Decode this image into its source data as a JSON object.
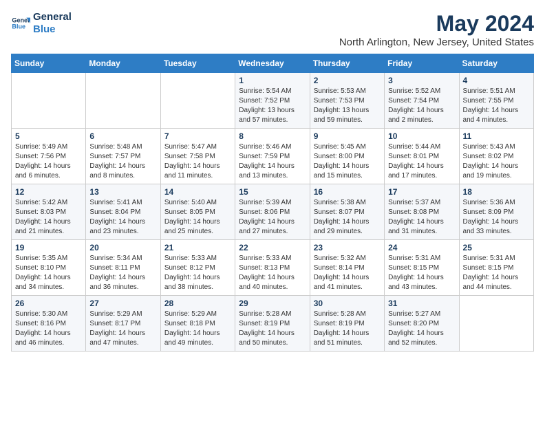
{
  "logo": {
    "line1": "General",
    "line2": "Blue"
  },
  "title": "May 2024",
  "subtitle": "North Arlington, New Jersey, United States",
  "weekdays": [
    "Sunday",
    "Monday",
    "Tuesday",
    "Wednesday",
    "Thursday",
    "Friday",
    "Saturday"
  ],
  "weeks": [
    [
      {
        "day": "",
        "info": ""
      },
      {
        "day": "",
        "info": ""
      },
      {
        "day": "",
        "info": ""
      },
      {
        "day": "1",
        "info": "Sunrise: 5:54 AM\nSunset: 7:52 PM\nDaylight: 13 hours\nand 57 minutes."
      },
      {
        "day": "2",
        "info": "Sunrise: 5:53 AM\nSunset: 7:53 PM\nDaylight: 13 hours\nand 59 minutes."
      },
      {
        "day": "3",
        "info": "Sunrise: 5:52 AM\nSunset: 7:54 PM\nDaylight: 14 hours\nand 2 minutes."
      },
      {
        "day": "4",
        "info": "Sunrise: 5:51 AM\nSunset: 7:55 PM\nDaylight: 14 hours\nand 4 minutes."
      }
    ],
    [
      {
        "day": "5",
        "info": "Sunrise: 5:49 AM\nSunset: 7:56 PM\nDaylight: 14 hours\nand 6 minutes."
      },
      {
        "day": "6",
        "info": "Sunrise: 5:48 AM\nSunset: 7:57 PM\nDaylight: 14 hours\nand 8 minutes."
      },
      {
        "day": "7",
        "info": "Sunrise: 5:47 AM\nSunset: 7:58 PM\nDaylight: 14 hours\nand 11 minutes."
      },
      {
        "day": "8",
        "info": "Sunrise: 5:46 AM\nSunset: 7:59 PM\nDaylight: 14 hours\nand 13 minutes."
      },
      {
        "day": "9",
        "info": "Sunrise: 5:45 AM\nSunset: 8:00 PM\nDaylight: 14 hours\nand 15 minutes."
      },
      {
        "day": "10",
        "info": "Sunrise: 5:44 AM\nSunset: 8:01 PM\nDaylight: 14 hours\nand 17 minutes."
      },
      {
        "day": "11",
        "info": "Sunrise: 5:43 AM\nSunset: 8:02 PM\nDaylight: 14 hours\nand 19 minutes."
      }
    ],
    [
      {
        "day": "12",
        "info": "Sunrise: 5:42 AM\nSunset: 8:03 PM\nDaylight: 14 hours\nand 21 minutes."
      },
      {
        "day": "13",
        "info": "Sunrise: 5:41 AM\nSunset: 8:04 PM\nDaylight: 14 hours\nand 23 minutes."
      },
      {
        "day": "14",
        "info": "Sunrise: 5:40 AM\nSunset: 8:05 PM\nDaylight: 14 hours\nand 25 minutes."
      },
      {
        "day": "15",
        "info": "Sunrise: 5:39 AM\nSunset: 8:06 PM\nDaylight: 14 hours\nand 27 minutes."
      },
      {
        "day": "16",
        "info": "Sunrise: 5:38 AM\nSunset: 8:07 PM\nDaylight: 14 hours\nand 29 minutes."
      },
      {
        "day": "17",
        "info": "Sunrise: 5:37 AM\nSunset: 8:08 PM\nDaylight: 14 hours\nand 31 minutes."
      },
      {
        "day": "18",
        "info": "Sunrise: 5:36 AM\nSunset: 8:09 PM\nDaylight: 14 hours\nand 33 minutes."
      }
    ],
    [
      {
        "day": "19",
        "info": "Sunrise: 5:35 AM\nSunset: 8:10 PM\nDaylight: 14 hours\nand 34 minutes."
      },
      {
        "day": "20",
        "info": "Sunrise: 5:34 AM\nSunset: 8:11 PM\nDaylight: 14 hours\nand 36 minutes."
      },
      {
        "day": "21",
        "info": "Sunrise: 5:33 AM\nSunset: 8:12 PM\nDaylight: 14 hours\nand 38 minutes."
      },
      {
        "day": "22",
        "info": "Sunrise: 5:33 AM\nSunset: 8:13 PM\nDaylight: 14 hours\nand 40 minutes."
      },
      {
        "day": "23",
        "info": "Sunrise: 5:32 AM\nSunset: 8:14 PM\nDaylight: 14 hours\nand 41 minutes."
      },
      {
        "day": "24",
        "info": "Sunrise: 5:31 AM\nSunset: 8:15 PM\nDaylight: 14 hours\nand 43 minutes."
      },
      {
        "day": "25",
        "info": "Sunrise: 5:31 AM\nSunset: 8:15 PM\nDaylight: 14 hours\nand 44 minutes."
      }
    ],
    [
      {
        "day": "26",
        "info": "Sunrise: 5:30 AM\nSunset: 8:16 PM\nDaylight: 14 hours\nand 46 minutes."
      },
      {
        "day": "27",
        "info": "Sunrise: 5:29 AM\nSunset: 8:17 PM\nDaylight: 14 hours\nand 47 minutes."
      },
      {
        "day": "28",
        "info": "Sunrise: 5:29 AM\nSunset: 8:18 PM\nDaylight: 14 hours\nand 49 minutes."
      },
      {
        "day": "29",
        "info": "Sunrise: 5:28 AM\nSunset: 8:19 PM\nDaylight: 14 hours\nand 50 minutes."
      },
      {
        "day": "30",
        "info": "Sunrise: 5:28 AM\nSunset: 8:19 PM\nDaylight: 14 hours\nand 51 minutes."
      },
      {
        "day": "31",
        "info": "Sunrise: 5:27 AM\nSunset: 8:20 PM\nDaylight: 14 hours\nand 52 minutes."
      },
      {
        "day": "",
        "info": ""
      }
    ]
  ]
}
